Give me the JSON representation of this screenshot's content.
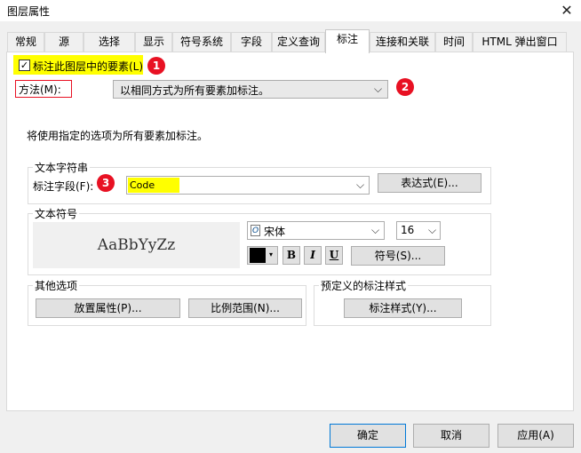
{
  "window": {
    "title": "图层属性",
    "close": "✕"
  },
  "tabs": [
    "常规",
    "源",
    "选择",
    "显示",
    "符号系统",
    "字段",
    "定义查询",
    "标注",
    "连接和关联",
    "时间",
    "HTML 弹出窗口"
  ],
  "active_tab": "标注",
  "label_checkbox": {
    "label": "标注此图层中的要素(L)",
    "checked": true,
    "mark": "✓"
  },
  "badges": [
    "1",
    "2",
    "3"
  ],
  "method": {
    "label": "方法(M):",
    "value": "以相同方式为所有要素加标注。"
  },
  "description": "将使用指定的选项为所有要素加标注。",
  "text_string": {
    "group_title": "文本字符串",
    "field_label": "标注字段(F):",
    "field_value": "Code",
    "expression_button": "表达式(E)..."
  },
  "text_symbol": {
    "group_title": "文本符号",
    "preview": "AaBbYyZz",
    "font": "宋体",
    "font_icon": "O",
    "size": "16",
    "bold": "B",
    "italic": "I",
    "underline": "U",
    "symbol_button": "符号(S)...",
    "color": "#000000"
  },
  "other_options": {
    "group_title": "其他选项",
    "placement_button": "放置属性(P)...",
    "scale_button": "比例范围(N)..."
  },
  "predefined": {
    "group_title": "预定义的标注样式",
    "style_button": "标注样式(Y)..."
  },
  "footer": {
    "ok": "确定",
    "cancel": "取消",
    "apply": "应用(A)"
  },
  "colors": {
    "highlight": "#ffff00",
    "badge": "#e81123"
  }
}
